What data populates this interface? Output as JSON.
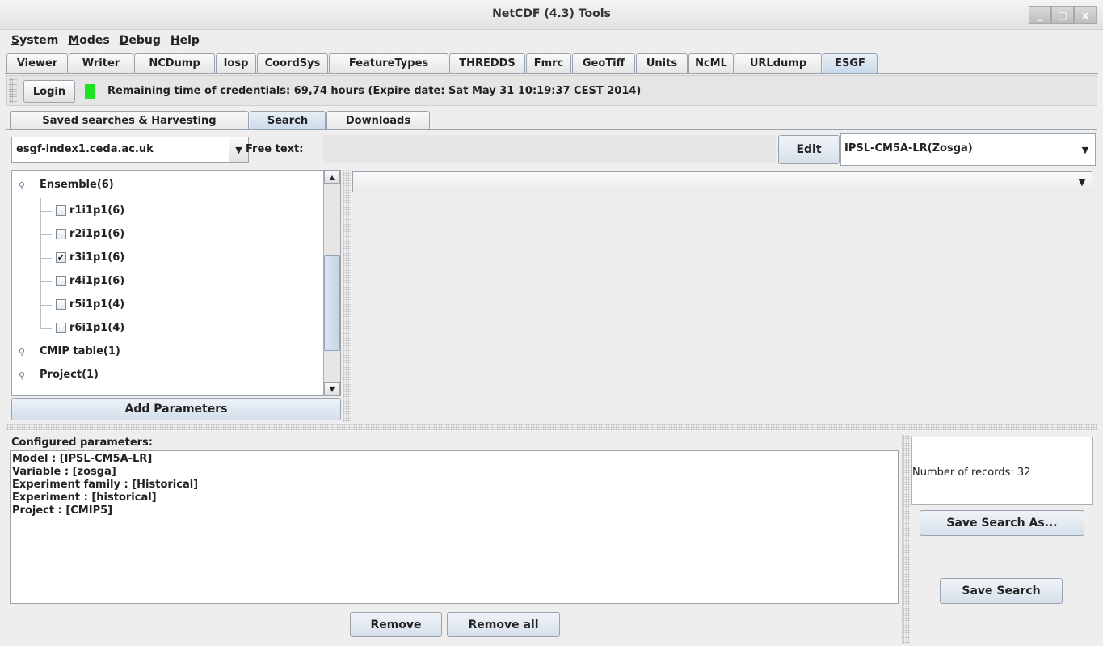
{
  "window": {
    "title": "NetCDF (4.3) Tools",
    "controls": {
      "minimize": "_",
      "maximize": "□",
      "close": "x"
    }
  },
  "menu": [
    {
      "first": "S",
      "rest": "ystem"
    },
    {
      "first": "M",
      "rest": "odes"
    },
    {
      "first": "D",
      "rest": "ebug"
    },
    {
      "first": "H",
      "rest": "elp"
    }
  ],
  "main_tabs": [
    "Viewer",
    "Writer",
    "NCDump",
    "Iosp",
    "CoordSys",
    "FeatureTypes",
    "THREDDS",
    "Fmrc",
    "GeoTiff",
    "Units",
    "NcML",
    "URLdump",
    "ESGF"
  ],
  "active_main_tab": "ESGF",
  "login": {
    "button": "Login",
    "status_color": "#1ee31e",
    "credentials_text": "Remaining time of credentials: 69,74 hours (Expire date: Sat May 31 10:19:37 CEST 2014)"
  },
  "sub_tabs": [
    "Saved searches & Harvesting",
    "Search",
    "Downloads"
  ],
  "active_sub_tab": "Search",
  "search": {
    "server": "esgf-index1.ceda.ac.uk",
    "free_text_label": "Free text:",
    "free_text_value": "",
    "edit_button": "Edit",
    "preset": "IPSL-CM5A-LR(Zosga)"
  },
  "tree": {
    "ensemble_label": "Ensemble(6)",
    "ensemble_items": [
      {
        "label": "r1i1p1(6)",
        "checked": false
      },
      {
        "label": "r2i1p1(6)",
        "checked": false
      },
      {
        "label": "r3i1p1(6)",
        "checked": true
      },
      {
        "label": "r4i1p1(6)",
        "checked": false
      },
      {
        "label": "r5i1p1(4)",
        "checked": false
      },
      {
        "label": "r6i1p1(4)",
        "checked": false
      }
    ],
    "cmip_table_label": "CMIP table(1)",
    "project_label": "Project(1)",
    "check_mark": "✔"
  },
  "add_parameters_button": "Add Parameters",
  "configured": {
    "title": "Configured parameters:",
    "lines": [
      "Model : [IPSL-CM5A-LR]",
      "Variable : [zosga]",
      "Experiment family : [Historical]",
      "Experiment : [historical]",
      "Project : [CMIP5]"
    ],
    "remove_button": "Remove",
    "remove_all_button": "Remove all"
  },
  "records": {
    "text": "Number of records: 32",
    "save_as_button": "Save Search As...",
    "save_button": "Save Search"
  },
  "icons": {
    "combo_arrow": "▼",
    "scroll_up": "▲",
    "scroll_down": "▼",
    "tree_key": "⚲"
  }
}
